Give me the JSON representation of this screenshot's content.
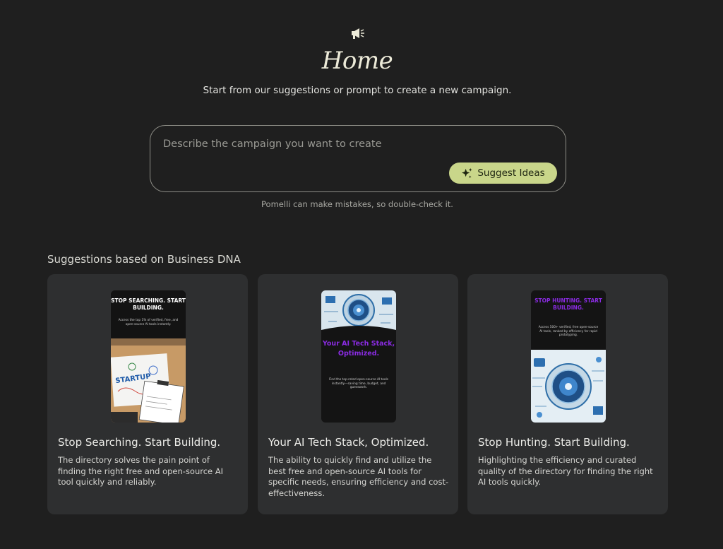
{
  "header": {
    "icon": "megaphone-icon",
    "title": "Home",
    "subtitle": "Start from our suggestions or prompt to create a new campaign."
  },
  "prompt": {
    "placeholder": "Describe the campaign you want to create",
    "value": "",
    "suggest_label": "Suggest Ideas",
    "suggest_icon": "sparkle-icon",
    "disclaimer": "Pomelli can make mistakes, so double-check it."
  },
  "suggestions": {
    "heading": "Suggestions based on Business DNA",
    "items": [
      {
        "title": "Stop Searching. Start Building.",
        "description": "The directory solves the pain point of finding the right free and open-source AI tool quickly and reliably.",
        "thumb_headline": "STOP SEARCHING. START BUILDING.",
        "thumb_body": "Access the top 1% of verified, free, and open-source AI tools instantly."
      },
      {
        "title": "Your AI Tech Stack, Optimized.",
        "description": "The ability to quickly find and utilize the best free and open-source AI tools for specific needs, ensuring efficiency and cost-effectiveness.",
        "thumb_headline": "Your AI Tech Stack, Optimized.",
        "thumb_body": "Find the top-rated open-source AI tools instantly—saving time, budget, and guesswork."
      },
      {
        "title": "Stop Hunting. Start Building.",
        "description": "Highlighting the efficiency and curated quality of the directory for finding the right AI tools quickly.",
        "thumb_headline": "STOP HUNTING. START BUILDING.",
        "thumb_body": "Access 500+ verified, free open-source AI tools, ranked by efficiency for rapid prototyping."
      }
    ]
  },
  "colors": {
    "background": "#1f1f1f",
    "card": "#2e2f30",
    "accent_button": "#c9d68a",
    "thumb_purple": "#8a2be2"
  }
}
